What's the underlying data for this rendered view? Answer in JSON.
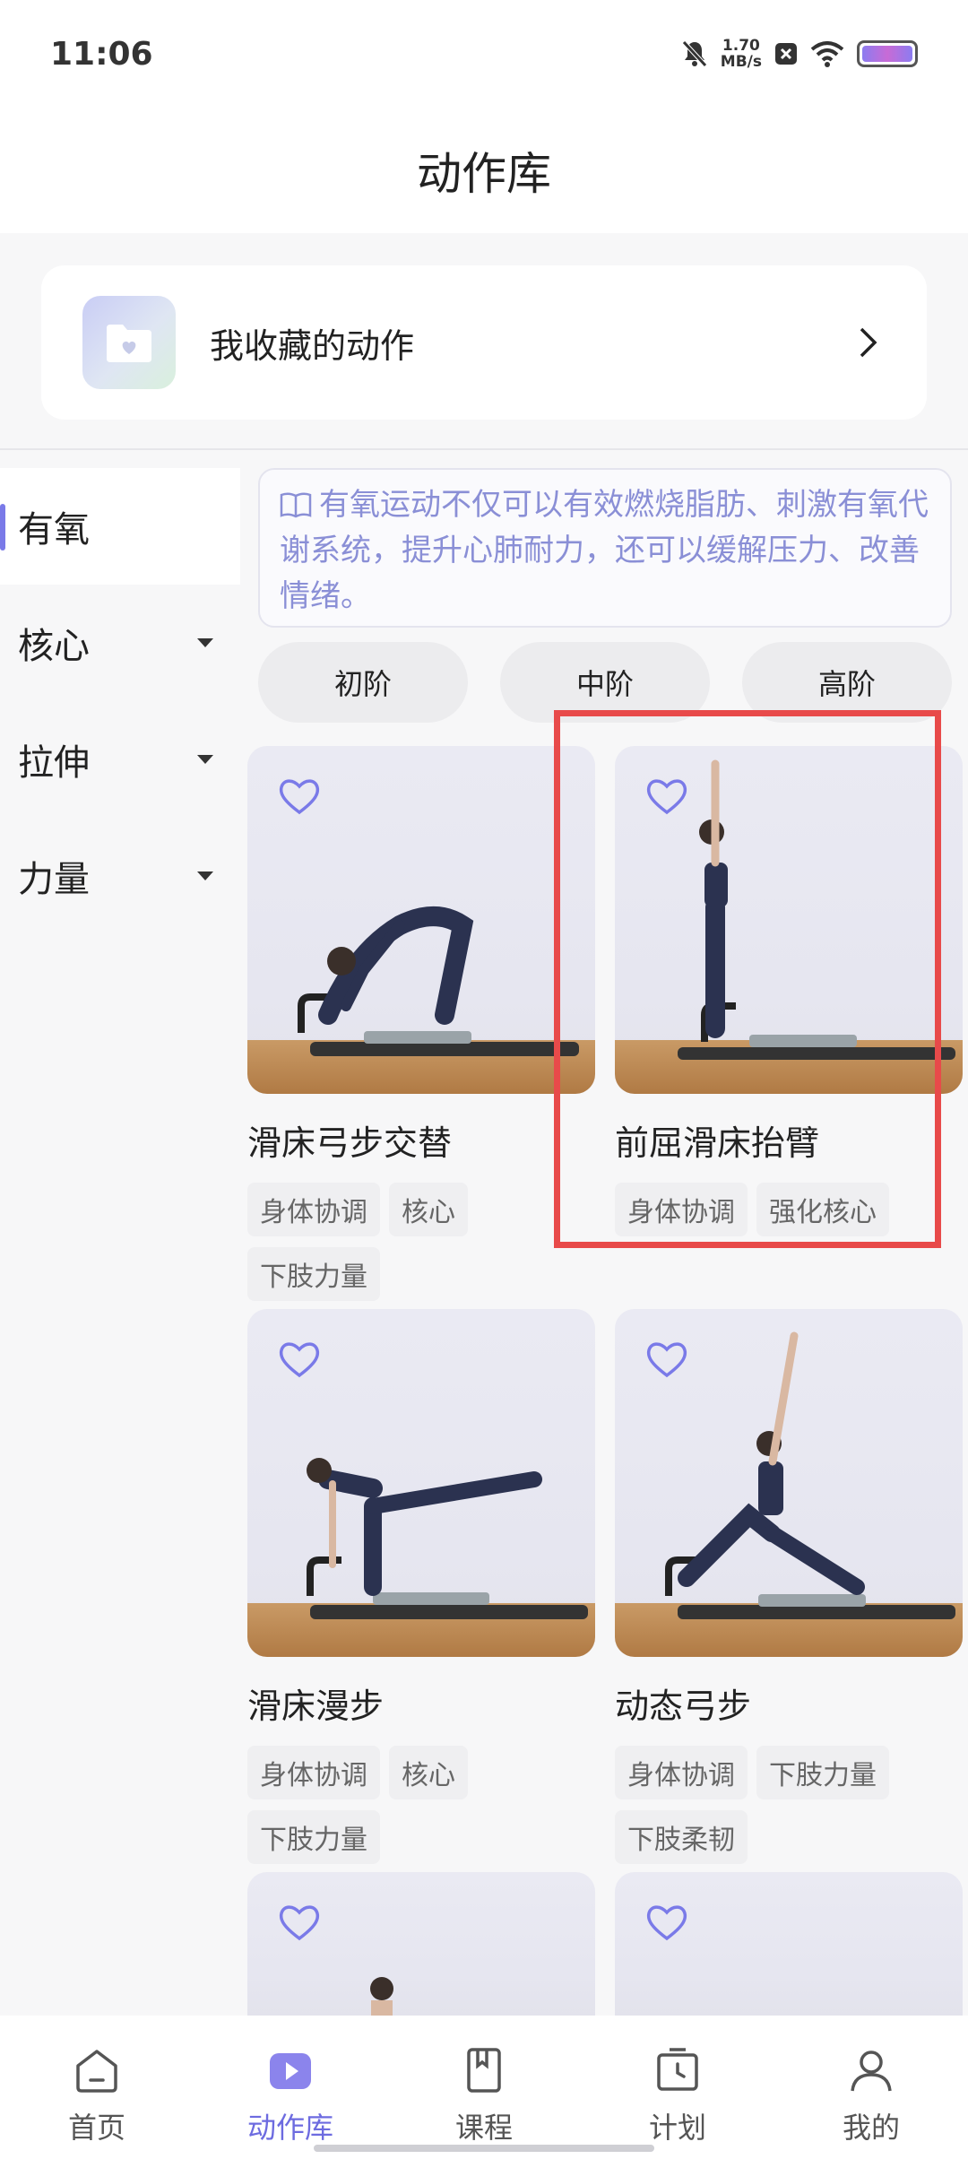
{
  "status_bar": {
    "time": "11:06",
    "net_speed_value": "1.70",
    "net_speed_unit": "MB/s"
  },
  "header": {
    "title": "动作库"
  },
  "favorites": {
    "label": "我收藏的动作"
  },
  "sidebar": {
    "items": [
      {
        "label": "有氧",
        "active": true
      },
      {
        "label": "核心",
        "active": false
      },
      {
        "label": "拉伸",
        "active": false
      },
      {
        "label": "力量",
        "active": false
      }
    ]
  },
  "tip": {
    "text": "有氧运动不仅可以有效燃烧脂肪、刺激有氧代谢系统，提升心肺耐力，还可以缓解压力、改善情绪。"
  },
  "levels": [
    "初阶",
    "中阶",
    "高阶"
  ],
  "exercises": [
    {
      "title": "滑床弓步交替",
      "tags": [
        "身体协调",
        "核心",
        "下肢力量"
      ]
    },
    {
      "title": "前屈滑床抬臂",
      "tags": [
        "身体协调",
        "强化核心"
      ]
    },
    {
      "title": "滑床漫步",
      "tags": [
        "身体协调",
        "核心",
        "下肢力量"
      ]
    },
    {
      "title": "动态弓步",
      "tags": [
        "身体协调",
        "下肢力量",
        "下肢柔韧"
      ]
    }
  ],
  "bottom_nav": [
    {
      "label": "首页",
      "icon": "home-icon"
    },
    {
      "label": "动作库",
      "icon": "play-icon",
      "active": true
    },
    {
      "label": "课程",
      "icon": "book-icon"
    },
    {
      "label": "计划",
      "icon": "clock-icon"
    },
    {
      "label": "我的",
      "icon": "user-icon"
    }
  ],
  "colors": {
    "accent": "#6d6be0",
    "highlight": "#e84a4a",
    "tip_text": "#8a8fd6"
  }
}
